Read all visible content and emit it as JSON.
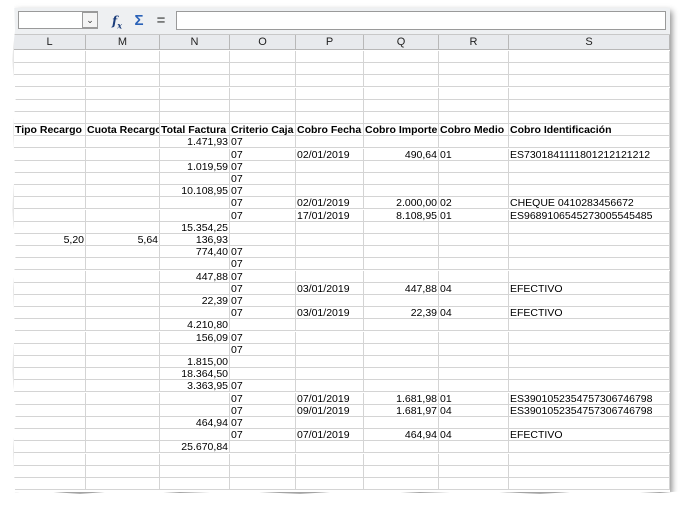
{
  "formula_bar": {
    "name_box_value": "",
    "formula_value": "",
    "icons": [
      "function-wizard-icon",
      "sum-icon",
      "equals-icon"
    ]
  },
  "columns": [
    {
      "id": "L",
      "header": "Tipo Recargo"
    },
    {
      "id": "M",
      "header": "Cuota Recargo"
    },
    {
      "id": "N",
      "header": "Total Factura"
    },
    {
      "id": "O",
      "header": "Criterio Caja"
    },
    {
      "id": "P",
      "header": "Cobro Fecha"
    },
    {
      "id": "Q",
      "header": "Cobro Importe"
    },
    {
      "id": "R",
      "header": "Cobro Medio"
    },
    {
      "id": "S",
      "header": "Cobro Identificación"
    }
  ],
  "rows": [
    [
      "",
      "",
      "",
      "",
      "",
      "",
      "",
      ""
    ],
    [
      "",
      "",
      "",
      "",
      "",
      "",
      "",
      ""
    ],
    [
      "",
      "",
      "",
      "",
      "",
      "",
      "",
      ""
    ],
    [
      "",
      "",
      "",
      "",
      "",
      "",
      "",
      ""
    ],
    [
      "",
      "",
      "",
      "",
      "",
      "",
      "",
      ""
    ],
    [
      "",
      "",
      "",
      "",
      "",
      "",
      "",
      ""
    ],
    [
      "Tipo Recargo",
      "Cuota Recargo",
      "Total Factura",
      "Criterio Caja",
      "Cobro Fecha",
      "Cobro Importe",
      "Cobro Medio",
      "Cobro Identificación"
    ],
    [
      "",
      "",
      "1.471,93",
      "07",
      "",
      "",
      "",
      ""
    ],
    [
      "",
      "",
      "",
      "07",
      "02/01/2019",
      "490,64",
      "01",
      "ES7301841111801212121212"
    ],
    [
      "",
      "",
      "1.019,59",
      "07",
      "",
      "",
      "",
      ""
    ],
    [
      "",
      "",
      "",
      "07",
      "",
      "",
      "",
      ""
    ],
    [
      "",
      "",
      "10.108,95",
      "07",
      "",
      "",
      "",
      ""
    ],
    [
      "",
      "",
      "",
      "07",
      "02/01/2019",
      "2.000,00",
      "02",
      "CHEQUE 0410283456672"
    ],
    [
      "",
      "",
      "",
      "07",
      "17/01/2019",
      "8.108,95",
      "01",
      "ES9689106545273005545485"
    ],
    [
      "",
      "",
      "15.354,25",
      "",
      "",
      "",
      "",
      ""
    ],
    [
      "5,20",
      "5,64",
      "136,93",
      "",
      "",
      "",
      "",
      ""
    ],
    [
      "",
      "",
      "774,40",
      "07",
      "",
      "",
      "",
      ""
    ],
    [
      "",
      "",
      "",
      "07",
      "",
      "",
      "",
      ""
    ],
    [
      "",
      "",
      "447,88",
      "07",
      "",
      "",
      "",
      ""
    ],
    [
      "",
      "",
      "",
      "07",
      "03/01/2019",
      "447,88",
      "04",
      "EFECTIVO"
    ],
    [
      "",
      "",
      "22,39",
      "07",
      "",
      "",
      "",
      ""
    ],
    [
      "",
      "",
      "",
      "07",
      "03/01/2019",
      "22,39",
      "04",
      "EFECTIVO"
    ],
    [
      "",
      "",
      "4.210,80",
      "",
      "",
      "",
      "",
      ""
    ],
    [
      "",
      "",
      "156,09",
      "07",
      "",
      "",
      "",
      ""
    ],
    [
      "",
      "",
      "",
      "07",
      "",
      "",
      "",
      ""
    ],
    [
      "",
      "",
      "1.815,00",
      "",
      "",
      "",
      "",
      ""
    ],
    [
      "",
      "",
      "18.364,50",
      "",
      "",
      "",
      "",
      ""
    ],
    [
      "",
      "",
      "3.363,95",
      "07",
      "",
      "",
      "",
      ""
    ],
    [
      "",
      "",
      "",
      "07",
      "07/01/2019",
      "1.681,98",
      "01",
      "ES3901052354757306746798"
    ],
    [
      "",
      "",
      "",
      "07",
      "09/01/2019",
      "1.681,97",
      "04",
      "ES3901052354757306746798"
    ],
    [
      "",
      "",
      "464,94",
      "07",
      "",
      "",
      "",
      ""
    ],
    [
      "",
      "",
      "",
      "07",
      "07/01/2019",
      "464,94",
      "04",
      "EFECTIVO"
    ],
    [
      "",
      "",
      "25.670,84",
      "",
      "",
      "",
      "",
      ""
    ],
    [
      "",
      "",
      "",
      "",
      "",
      "",
      "",
      ""
    ],
    [
      "",
      "",
      "",
      "",
      "",
      "",
      "",
      ""
    ],
    [
      "",
      "",
      "",
      "",
      "",
      "",
      "",
      ""
    ]
  ]
}
